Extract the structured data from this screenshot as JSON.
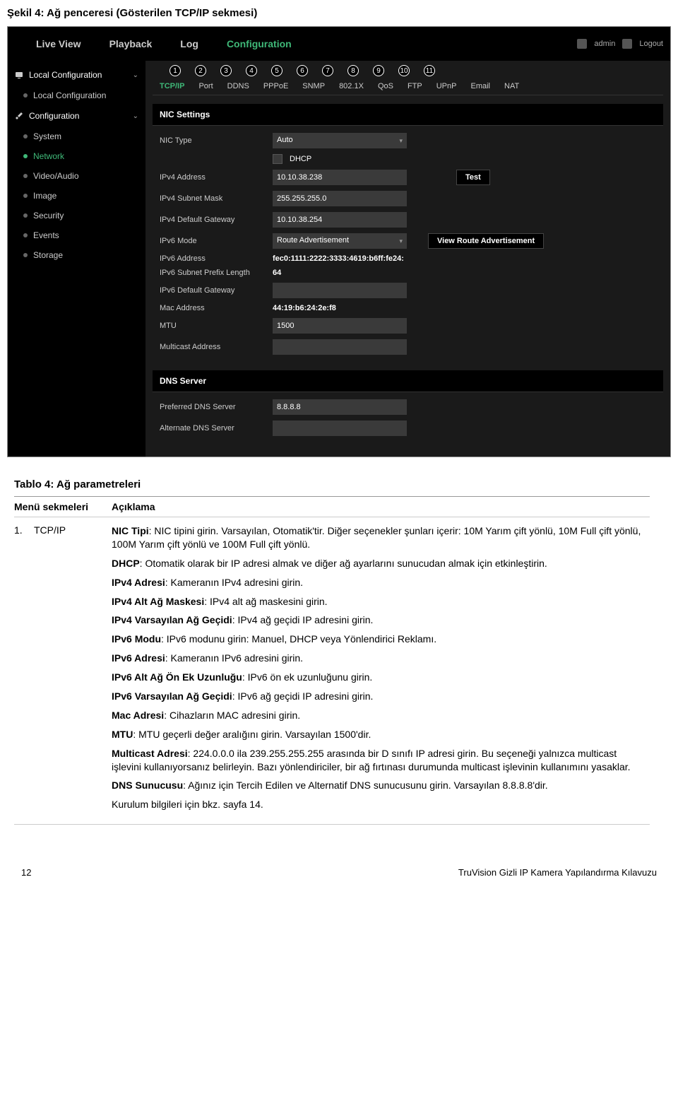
{
  "page_title": "Şekil 4: Ağ penceresi (Gösterilen TCP/IP sekmesi)",
  "header": {
    "tabs": [
      "Live View",
      "Playback",
      "Log",
      "Configuration"
    ],
    "active_tab": 3,
    "user": "admin",
    "logout": "Logout"
  },
  "sidebar": {
    "groups": [
      {
        "label": "Local Configuration",
        "icon": "monitor",
        "expanded": true,
        "items": [
          {
            "label": "Local Configuration",
            "active": false
          }
        ]
      },
      {
        "label": "Configuration",
        "icon": "wrench",
        "expanded": true,
        "items": [
          {
            "label": "System",
            "active": false
          },
          {
            "label": "Network",
            "active": true
          },
          {
            "label": "Video/Audio",
            "active": false
          },
          {
            "label": "Image",
            "active": false
          },
          {
            "label": "Security",
            "active": false
          },
          {
            "label": "Events",
            "active": false
          },
          {
            "label": "Storage",
            "active": false
          }
        ]
      }
    ]
  },
  "numbered": [
    "1",
    "2",
    "3",
    "4",
    "5",
    "6",
    "7",
    "8",
    "9",
    "10",
    "11"
  ],
  "subtabs": [
    "TCP/IP",
    "Port",
    "DDNS",
    "PPPoE",
    "SNMP",
    "802.1X",
    "QoS",
    "FTP",
    "UPnP",
    "Email",
    "NAT"
  ],
  "subtab_active": 0,
  "nic": {
    "section": "NIC Settings",
    "nic_type_label": "NIC Type",
    "nic_type_value": "Auto",
    "dhcp_label": "DHCP",
    "ipv4_addr_label": "IPv4 Address",
    "ipv4_addr_value": "10.10.38.238",
    "test_btn": "Test",
    "ipv4_mask_label": "IPv4 Subnet Mask",
    "ipv4_mask_value": "255.255.255.0",
    "ipv4_gw_label": "IPv4 Default Gateway",
    "ipv4_gw_value": "10.10.38.254",
    "ipv6_mode_label": "IPv6 Mode",
    "ipv6_mode_value": "Route Advertisement",
    "view_route_btn": "View Route Advertisement",
    "ipv6_addr_label": "IPv6 Address",
    "ipv6_addr_value": "fec0:1111:2222:3333:4619:b6ff:fe24:",
    "ipv6_prefix_label": "IPv6 Subnet Prefix Length",
    "ipv6_prefix_value": "64",
    "ipv6_gw_label": "IPv6 Default Gateway",
    "ipv6_gw_value": "",
    "mac_label": "Mac Address",
    "mac_value": "44:19:b6:24:2e:f8",
    "mtu_label": "MTU",
    "mtu_value": "1500",
    "multicast_label": "Multicast Address",
    "multicast_value": ""
  },
  "dns": {
    "section": "DNS Server",
    "pref_label": "Preferred DNS Server",
    "pref_value": "8.8.8.8",
    "alt_label": "Alternate DNS Server",
    "alt_value": ""
  },
  "doc": {
    "title": "Tablo 4: Ağ parametreleri",
    "col1": "Menü sekmeleri",
    "col2": "Açıklama",
    "row_num": "1.",
    "row_name": "TCP/IP",
    "paragraphs": [
      "<b>NIC Tipi</b>: NIC tipini girin. Varsayılan, Otomatik'tir. Diğer seçenekler şunları içerir: 10M Yarım çift yönlü, 10M Full çift yönlü, 100M Yarım çift yönlü ve 100M Full çift yönlü.",
      "<b>DHCP</b>: Otomatik olarak bir IP adresi almak ve diğer ağ ayarlarını sunucudan almak için etkinleştirin.",
      "<b>IPv4 Adresi</b>: Kameranın IPv4 adresini girin.",
      "<b>IPv4 Alt Ağ Maskesi</b>: IPv4 alt ağ maskesini girin.",
      "<b>IPv4 Varsayılan Ağ Geçidi</b>: IPv4 ağ geçidi IP adresini girin.",
      "<b>IPv6 Modu</b>: IPv6 modunu girin: Manuel, DHCP veya Yönlendirici Reklamı.",
      "<b>IPv6 Adresi</b>: Kameranın IPv6 adresini girin.",
      "<b>IPv6 Alt Ağ Ön Ek Uzunluğu</b>: IPv6 ön ek uzunluğunu girin.",
      "<b>IPv6 Varsayılan Ağ Geçidi</b>: IPv6 ağ geçidi IP adresini girin.",
      "<b>Mac Adresi</b>: Cihazların MAC adresini girin.",
      "<b>MTU</b>: MTU geçerli değer aralığını girin. Varsayılan 1500'dir.",
      "<b>Multicast Adresi</b>: 224.0.0.0 ila 239.255.255.255 arasında bir D sınıfı IP adresi girin. Bu seçeneği yalnızca multicast işlevini kullanıyorsanız belirleyin. Bazı yönlendiriciler, bir ağ fırtınası durumunda multicast işlevinin kullanımını yasaklar.",
      "<b>DNS Sunucusu</b>: Ağınız için Tercih Edilen ve Alternatif DNS sunucusunu girin. Varsayılan 8.8.8.8'dir.",
      "Kurulum bilgileri için bkz. sayfa 14."
    ]
  },
  "footer": {
    "left": "12",
    "right": "TruVision Gizli IP Kamera Yapılandırma Kılavuzu"
  }
}
